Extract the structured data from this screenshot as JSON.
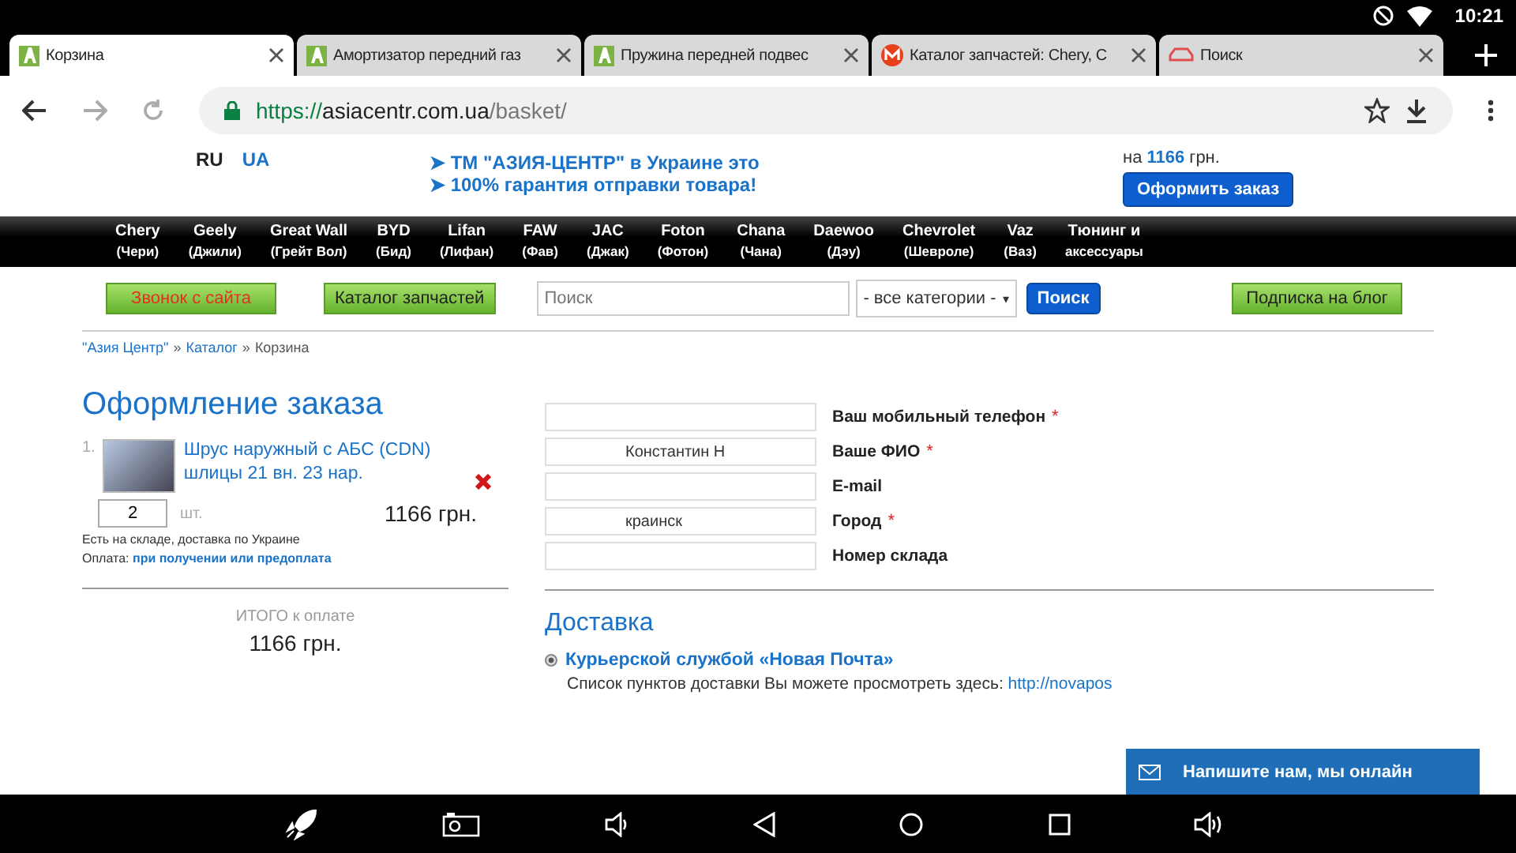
{
  "status_bar": {
    "time": "10:21"
  },
  "tabs": [
    {
      "title": "Корзина",
      "selected": true
    },
    {
      "title": "Амортизатор передний газ",
      "selected": false
    },
    {
      "title": "Пружина передней подвес",
      "selected": false
    },
    {
      "title": "Каталог запчастей: Chery, C",
      "selected": false
    },
    {
      "title": "Поиск",
      "selected": false
    }
  ],
  "address_bar": {
    "scheme": "https://",
    "host": "asiacentr.com.ua",
    "path": "/basket/"
  },
  "header": {
    "languages": [
      {
        "label": "RU",
        "selected": true
      },
      {
        "label": "UA",
        "selected": false
      }
    ],
    "promo": [
      "➤ ТМ \"АЗИЯ-ЦЕНТР\" в Украине это",
      "➤ 100% гарантия отправки товара!"
    ],
    "cart_prefix": "на",
    "cart_sum": "1166",
    "cart_suffix": "грн.",
    "checkout_button": "Оформить заказ"
  },
  "brands": [
    {
      "name": "Chery",
      "local": "(Чери)"
    },
    {
      "name": "Geely",
      "local": "(Джили)"
    },
    {
      "name": "Great Wall",
      "local": "(Грейт Вол)"
    },
    {
      "name": "BYD",
      "local": "(Бид)"
    },
    {
      "name": "Lifan",
      "local": "(Лифан)"
    },
    {
      "name": "FAW",
      "local": "(Фав)"
    },
    {
      "name": "JAC",
      "local": "(Джак)"
    },
    {
      "name": "Foton",
      "local": "(Фотон)"
    },
    {
      "name": "Chana",
      "local": "(Чана)"
    },
    {
      "name": "Daewoo",
      "local": "(Дэу)"
    },
    {
      "name": "Chevrolet",
      "local": "(Шевроле)"
    },
    {
      "name": "Vaz",
      "local": "(Ваз)"
    },
    {
      "name": "Тюнинг и",
      "local": "аксессуары"
    }
  ],
  "toolbar": {
    "call_button": "Звонок с сайта",
    "catalog_button": "Каталог запчастей",
    "search_placeholder": "Поиск",
    "category": "- все категории -",
    "category_caret": "▾",
    "search_button": "Поиск",
    "blog_button": "Подписка на блог"
  },
  "breadcrumb": [
    {
      "text": "\"Азия Центр\""
    },
    {
      "separator": "»",
      "text": "Каталог"
    },
    {
      "separator": "»",
      "text": "Корзина"
    }
  ],
  "order": {
    "title": "Оформление заказа",
    "items": [
      {
        "number": "1.",
        "name": "Шрус наружный с АБС (CDN) шлицы 21 вн. 23 нар.",
        "quantity": "2",
        "unit": "шт.",
        "price": "1166 грн.",
        "stock": "Есть на складе, доставка по Украине",
        "payment_label": "Оплата:",
        "payment": "при получении или предоплата"
      }
    ],
    "total_label": "ИТОГО к оплате",
    "total": "1166 грн."
  },
  "form": [
    {
      "label": "Ваш мобильный телефон",
      "required_mark": "*"
    },
    {
      "label": "Ваше ФИО",
      "required_mark": "*",
      "value": "Константин Н"
    },
    {
      "label": "E-mail"
    },
    {
      "label": "Город",
      "required_mark": "*",
      "value": "краинск"
    },
    {
      "label": "Номер склада"
    }
  ],
  "delivery": {
    "title": "Доставка",
    "options": [
      {
        "label": "Курьерской службой «Новая Почта»",
        "selected": true,
        "note": "Список пунктов доставки Вы можете просмотреть здесь:",
        "link": "http://novapos"
      }
    ]
  },
  "chat": {
    "label": "Напишите нам, мы онлайн"
  }
}
